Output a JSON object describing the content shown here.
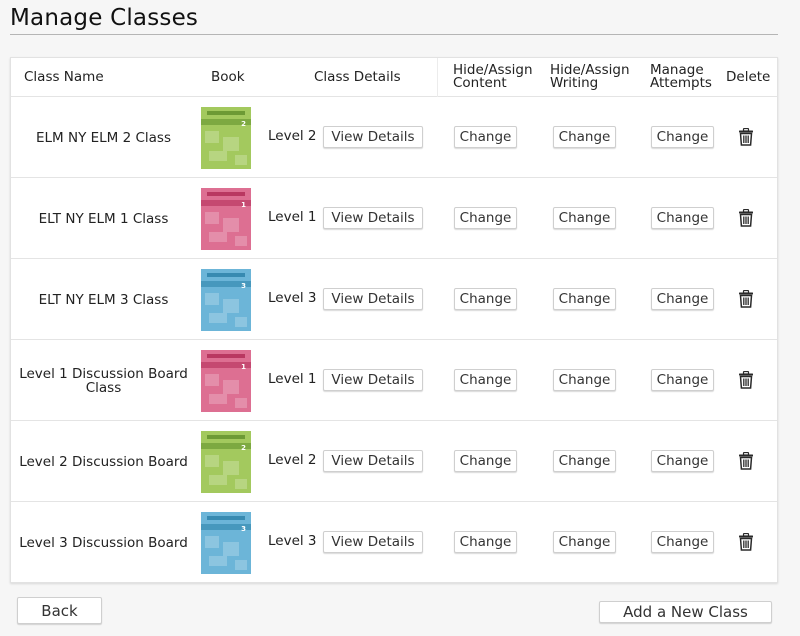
{
  "page_title": "Manage Classes",
  "table": {
    "headers": {
      "class_name": "Class Name",
      "book": "Book",
      "class_details": "Class Details",
      "hide_assign_content_1": "Hide/Assign",
      "hide_assign_content_2": "Content",
      "hide_assign_writing_1": "Hide/Assign",
      "hide_assign_writing_2": "Writing",
      "manage_attempts_1": "Manage",
      "manage_attempts_2": "Attempts",
      "delete": "Delete"
    },
    "rows": [
      {
        "class_name": "ELM NY ELM 2 Class",
        "level": "Level 2",
        "book_number": "2",
        "book_color": "#a3c95e",
        "book_dark": "#5f8e2a",
        "view": "View Details",
        "change1": "Change",
        "change2": "Change",
        "change3": "Change"
      },
      {
        "class_name": "ELT NY ELM 1 Class",
        "level": "Level 1",
        "book_number": "1",
        "book_color": "#dd6f92",
        "book_dark": "#b02a55",
        "view": "View Details",
        "change1": "Change",
        "change2": "Change",
        "change3": "Change"
      },
      {
        "class_name": "ELT NY ELM 3 Class",
        "level": "Level 3",
        "book_number": "3",
        "book_color": "#6cb5d8",
        "book_dark": "#2a7fa8",
        "view": "View Details",
        "change1": "Change",
        "change2": "Change",
        "change3": "Change"
      },
      {
        "class_name": "Level 1 Discussion Board Class",
        "level": "Level 1",
        "book_number": "1",
        "book_color": "#dd6f92",
        "book_dark": "#b02a55",
        "view": "View Details",
        "change1": "Change",
        "change2": "Change",
        "change3": "Change"
      },
      {
        "class_name": "Level 2 Discussion Board",
        "level": "Level 2",
        "book_number": "2",
        "book_color": "#a3c95e",
        "book_dark": "#5f8e2a",
        "view": "View Details",
        "change1": "Change",
        "change2": "Change",
        "change3": "Change"
      },
      {
        "class_name": "Level 3 Discussion Board",
        "level": "Level 3",
        "book_number": "3",
        "book_color": "#6cb5d8",
        "book_dark": "#2a7fa8",
        "view": "View Details",
        "change1": "Change",
        "change2": "Change",
        "change3": "Change"
      }
    ]
  },
  "icons": {
    "book": "book-cover-icon",
    "delete": "trash-icon"
  },
  "footer": {
    "back_label": "Back",
    "add_label": "Add a New Class"
  }
}
